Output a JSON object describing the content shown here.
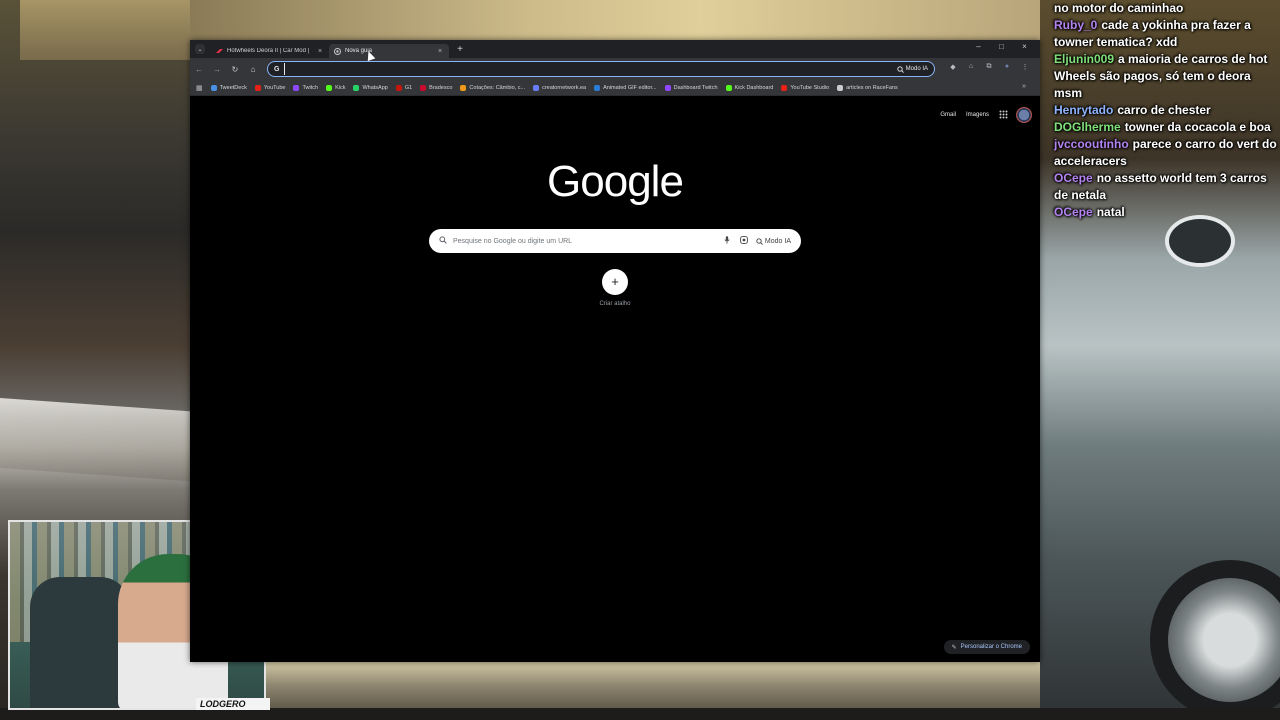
{
  "chat": [
    {
      "user": "",
      "user_color": "#ffffff",
      "text": "no motor do caminhao"
    },
    {
      "user": "Ruby_0",
      "user_color": "#b383f0",
      "text": "cade a yokinha pra fazer a towner tematica? xdd"
    },
    {
      "user": "Eljunin009",
      "user_color": "#7fe07a",
      "text": "a maioria de carros de hot Wheels são pagos, só tem o deora msm"
    },
    {
      "user": "Henrytado",
      "user_color": "#8fb4ff",
      "text": "carro de chester"
    },
    {
      "user": "DOGlherme",
      "user_color": "#7fe07a",
      "text": "towner da cocacola e boa"
    },
    {
      "user": "jvccooutinho",
      "user_color": "#b383f0",
      "text": "parece o carro do vert do acceleracers"
    },
    {
      "user": "OCepe",
      "user_color": "#b383f0",
      "text": "no assetto world tem 3 carros de netala"
    },
    {
      "user": "OCepe",
      "user_color": "#b383f0",
      "text": "natal"
    }
  ],
  "webcam": {
    "logo_text": "LODGERO"
  },
  "browser": {
    "tabs": [
      {
        "title": "Hotwheels Deora II | Car Mod |",
        "close": "×",
        "favicon_color": "#e8344a",
        "active": false
      },
      {
        "title": "Nova guia",
        "close": "×",
        "favicon_color": "#9aa0a6",
        "active": true
      }
    ],
    "new_tab": "+",
    "window_controls": {
      "minimize": "–",
      "maximize": "□",
      "close": "×"
    },
    "nav": {
      "back": "←",
      "forward": "→",
      "reload": "↻",
      "home": "⌂"
    },
    "omnibox": {
      "value": "",
      "placeholder": "",
      "g_label": "G",
      "mode_label": "Modo IA"
    },
    "extensions": {
      "ext1": "◆",
      "ext2": "⌂",
      "ext3": "⧉",
      "profile": "●",
      "menu": "⋮"
    },
    "bookmarks": [
      {
        "label": "TweetDeck",
        "color": "#4a90e2"
      },
      {
        "label": "YouTube",
        "color": "#e62117"
      },
      {
        "label": "Twitch",
        "color": "#9146ff"
      },
      {
        "label": "Kick",
        "color": "#53fc18"
      },
      {
        "label": "WhatsApp",
        "color": "#25d366"
      },
      {
        "label": "G1",
        "color": "#c4170c"
      },
      {
        "label": "Bradesco",
        "color": "#cc092f"
      },
      {
        "label": "Cotações: Câmbio, c...",
        "color": "#f09a1a"
      },
      {
        "label": "creatornetwork.ea",
        "color": "#6a7cff"
      },
      {
        "label": "Animated GIF editor...",
        "color": "#2b7bd8"
      },
      {
        "label": "Dashboard Twitch",
        "color": "#9146ff"
      },
      {
        "label": "Kick Dashboard",
        "color": "#53fc18"
      },
      {
        "label": "YouTube Studio",
        "color": "#e62117"
      },
      {
        "label": "articles on RaceFans",
        "color": "#cccccc"
      }
    ],
    "bookmarks_more": "»",
    "ntp": {
      "gmail": "Gmail",
      "images": "Imagens",
      "apps_icon": "⋮⋮⋮",
      "logo": "Google",
      "search_placeholder": "Pesquise no Google ou digite um URL",
      "search_icon": "🔍",
      "mic_icon": "🎤",
      "lens_icon": "◎",
      "ai_mode": "Modo IA",
      "shortcut_plus": "+",
      "shortcut_label": "Criar atalho",
      "customize": "Personalizar o Chrome",
      "customize_icon": "✎"
    }
  }
}
